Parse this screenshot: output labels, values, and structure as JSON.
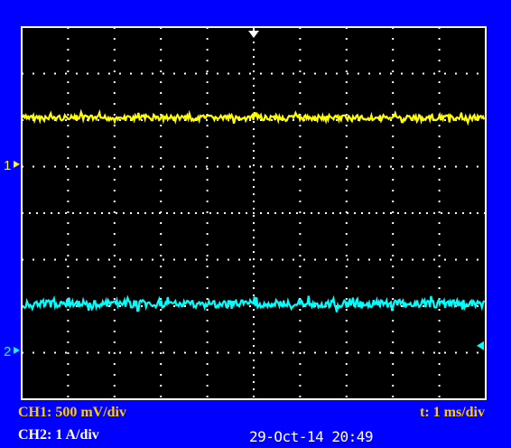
{
  "colors": {
    "background": "#0000ff",
    "screen": "#000000",
    "grid": "#ffffff",
    "ch1": "#ffff00",
    "ch2": "#00ffff",
    "label_ch1": "#ffcc00",
    "label_ch2": "#ffffff",
    "timestamp": "#ffffff"
  },
  "channels": [
    {
      "id": "CH1",
      "scale_label": "CH1: 500 mV/div",
      "marker": "1",
      "level_div": 6.05,
      "marker_div": 5.05,
      "noise_div": 0.12
    },
    {
      "id": "CH2",
      "scale_label": "CH2: 1 A/div",
      "marker": "2",
      "level_div": 2.05,
      "marker_div": 1.05,
      "noise_div": 0.16
    }
  ],
  "timebase": {
    "label": "t: 1 ms/div"
  },
  "grid": {
    "h_divisions": 10,
    "v_divisions": 8
  },
  "timestamp": "29-Oct-14 20:49",
  "icons": {
    "trigger_position": "trigger-down-arrow-icon",
    "trigger_level": "trigger-left-arrow-icon"
  }
}
